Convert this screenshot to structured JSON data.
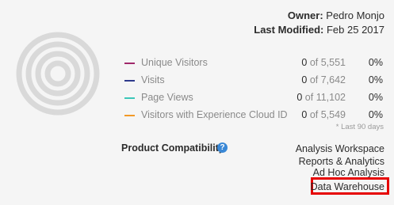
{
  "owner": {
    "label": "Owner:",
    "value": "Pedro Monjo"
  },
  "last_modified": {
    "label": "Last Modified:",
    "value": "Feb 25 2017"
  },
  "metrics": [
    {
      "name": "Unique Visitors",
      "count": "0",
      "of": "of 5,551",
      "pct": "0%",
      "color": "#a0286a"
    },
    {
      "name": "Visits",
      "count": "0",
      "of": "of 7,642",
      "pct": "0%",
      "color": "#2e3a8c"
    },
    {
      "name": "Page Views",
      "count": "0",
      "of": "of 11,102",
      "pct": "0%",
      "color": "#3cc7b9"
    },
    {
      "name": "Visitors with Experience Cloud ID",
      "count": "0",
      "of": "of 5,549",
      "pct": "0%",
      "color": "#f29a27"
    }
  ],
  "note": "* Last 90 days",
  "product_compatibility": {
    "label": "Product Compatibility",
    "help_icon": "?",
    "items": [
      "Analysis Workspace",
      "Reports & Analytics",
      "Ad Hoc Analysis",
      "Data Warehouse"
    ],
    "highlighted": "Data Warehouse",
    "highlight_color": "#e60000"
  }
}
